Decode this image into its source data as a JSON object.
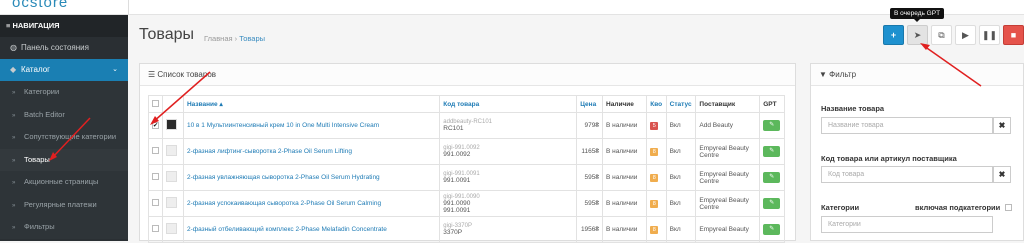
{
  "brand": {
    "logo": "ocstore"
  },
  "sidebar": {
    "header": "≡ НАВИГАЦИЯ",
    "items": [
      {
        "label": "Панель состояния",
        "icon": "dashboard-icon"
      },
      {
        "label": "Каталог",
        "icon": "tag-icon"
      }
    ],
    "subitems": [
      "Категории",
      "Batch Editor",
      "Сопутствующие категории",
      "Товары",
      "Акционные страницы",
      "Регулярные платежи",
      "Фильтры"
    ]
  },
  "page": {
    "title": "Товары",
    "breadcrumb_home": "Главная",
    "breadcrumb_sep": "›",
    "breadcrumb_current": "Товары"
  },
  "toolbar": {
    "tooltip": "В очередь GPT",
    "add": "+",
    "gpt": "➤",
    "copy": "⧉",
    "play": "▶",
    "pause": "❚❚",
    "delete": "🗑"
  },
  "list": {
    "title": "Список товаров",
    "columns": [
      "",
      "",
      "Название ▴",
      "Код товара",
      "Цена",
      "Наличие",
      "Кво",
      "Статус",
      "Поставщик",
      "GPT"
    ],
    "rows": [
      {
        "checked": "✔",
        "name": "10 в 1 Мультиинтенсивный крем 10 in One Multi Intensive Cream",
        "code1": "addbeauty-RC101",
        "code2": "RC101",
        "code3": "",
        "price": "979₴",
        "stock": "В наличии",
        "qty": "5",
        "qty_color": "red",
        "status": "Вкл",
        "supplier": "Add Beauty"
      },
      {
        "checked": "",
        "name": "2-фазная лифтинг-сыворотка 2-Phase Oil Serum Lifting",
        "code1": "gigi-991.0092",
        "code2": "991.0092",
        "code3": "",
        "price": "1165₴",
        "stock": "В наличии",
        "qty": "8",
        "qty_color": "orange",
        "status": "Вкл",
        "supplier": "Empyreal Beauty Centre"
      },
      {
        "checked": "",
        "name": "2-фазная увлажняющая сыворотка 2-Phase Oil Serum Hydrating",
        "code1": "gigi-991.0091",
        "code2": "991.0091",
        "code3": "",
        "price": "595₴",
        "stock": "В наличии",
        "qty": "8",
        "qty_color": "orange",
        "status": "Вкл",
        "supplier": "Empyreal Beauty Centre"
      },
      {
        "checked": "",
        "name": "2-фазная успокаивающая сыворотка 2-Phase Oil Serum Calming",
        "code1": "gigi-991.0090",
        "code2": "991.0090",
        "code3": "991.0091",
        "price": "595₴",
        "stock": "В наличии",
        "qty": "8",
        "qty_color": "orange",
        "status": "Вкл",
        "supplier": "Empyreal Beauty Centre"
      },
      {
        "checked": "",
        "name": "2-фазный отбеливающий комплекс 2-Phase Melafadin Concentrate",
        "code1": "gigi-3370P",
        "code2": "3370P",
        "code3": "",
        "price": "1956₴",
        "stock": "В наличии",
        "qty": "8",
        "qty_color": "orange",
        "status": "Вкл",
        "supplier": "Empyreal Beauty"
      }
    ]
  },
  "filter": {
    "title": "Фильтр",
    "name_label": "Название товара",
    "name_placeholder": "Название товара",
    "code_label": "Код товара или артикул поставщика",
    "code_placeholder": "Код товара",
    "cat_label": "Категории",
    "cat_sub_label": "включая подкатегории",
    "cat_placeholder": "Категории",
    "clear": "✖"
  },
  "colors": {
    "accent": "#1e91cf",
    "sidebar": "#2a2f33",
    "active": "#1a7fb3",
    "annotation": "#e02020"
  }
}
